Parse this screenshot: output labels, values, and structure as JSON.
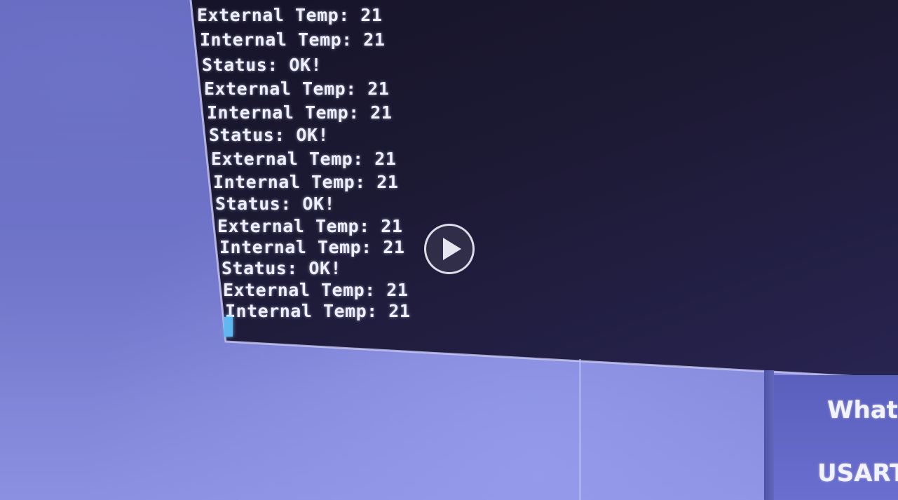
{
  "terminal": {
    "lines": [
      "External Temp: 21",
      "Internal Temp: 21",
      "Status: OK!",
      "External Temp: 21",
      "Internal Temp: 21",
      "Status: OK!",
      "External Temp: 21",
      "Internal Temp: 21",
      "Status: OK!",
      "External Temp: 21",
      "Internal Temp: 21",
      "Status: OK!",
      "External Temp: 21",
      "Internal Temp: 21"
    ]
  },
  "side_panel": {
    "line1": "What",
    "line2": "USART"
  },
  "video": {
    "play_icon": "play-icon"
  },
  "colors": {
    "terminal_bg": "#1c1933",
    "terminal_text": "#eef0ff",
    "cursor": "#5fb8f0",
    "desktop": "#6e73c8"
  }
}
